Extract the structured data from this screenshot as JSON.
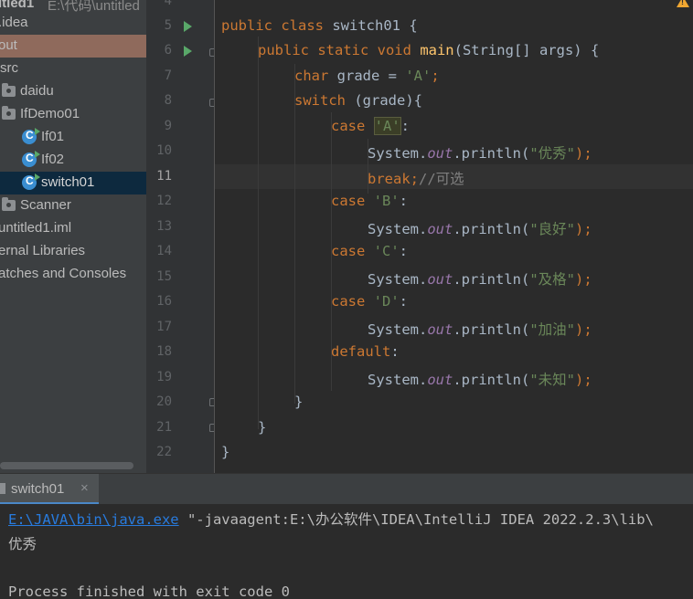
{
  "sidebar": {
    "header": "itled1",
    "header_path": "E:\\代码\\untitled",
    "items": [
      {
        "label": ".idea",
        "kind": "folder"
      },
      {
        "label": "out",
        "kind": "folder"
      },
      {
        "label": "src",
        "kind": "folder"
      },
      {
        "label": "daidu",
        "kind": "package"
      },
      {
        "label": "IfDemo01",
        "kind": "package"
      },
      {
        "label": "If01",
        "kind": "class"
      },
      {
        "label": "If02",
        "kind": "class"
      },
      {
        "label": "switch01",
        "kind": "class"
      },
      {
        "label": "Scanner",
        "kind": "package"
      },
      {
        "label": "untitled1.iml",
        "kind": "file"
      },
      {
        "label": "ernal Libraries",
        "kind": "library"
      },
      {
        "label": "atches and Consoles",
        "kind": "scratch"
      }
    ]
  },
  "editor": {
    "line_numbers": [
      "4",
      "5",
      "6",
      "7",
      "8",
      "9",
      "10",
      "11",
      "12",
      "13",
      "14",
      "15",
      "16",
      "17",
      "18",
      "19",
      "20",
      "21",
      "22"
    ],
    "current_line": "11",
    "lines": {
      "l5": [
        "public class ",
        "switch01 {"
      ],
      "l6": [
        "public static void ",
        "main",
        "(String[] args) {"
      ],
      "l7": [
        "char ",
        "grade = ",
        "'A'",
        ";"
      ],
      "l8": [
        "switch ",
        "(grade){"
      ],
      "l9": [
        "case ",
        "'A'",
        ":"
      ],
      "l10": [
        "System.",
        "out",
        ".println(",
        "\"优秀\"",
        ");"
      ],
      "l11": [
        "break",
        ";",
        "//可选"
      ],
      "l12": [
        "case ",
        "'B'",
        ":"
      ],
      "l13": [
        "System.",
        "out",
        ".println(",
        "\"良好\"",
        ");"
      ],
      "l14": [
        "case ",
        "'C'",
        ":"
      ],
      "l15": [
        "System.",
        "out",
        ".println(",
        "\"及格\"",
        ");"
      ],
      "l16": [
        "case ",
        "'D'",
        ":"
      ],
      "l17": [
        "System.",
        "out",
        ".println(",
        "\"加油\"",
        ");"
      ],
      "l18": [
        "default",
        ":"
      ],
      "l19": [
        "System.",
        "out",
        ".println(",
        "\"未知\"",
        ");"
      ],
      "l20": "}",
      "l21": "}",
      "l22": "}"
    }
  },
  "run_panel": {
    "tab_label": "switch01",
    "close_glyph": "×",
    "console": {
      "exe_link": "E:\\JAVA\\bin\\java.exe",
      "args": " \"-javaagent:E:\\办公软件\\IDEA\\IntelliJ IDEA 2022.2.3\\lib\\",
      "output": "优秀",
      "exit": "Process finished with exit code 0"
    }
  },
  "colors": {
    "keyword": "#cc7832",
    "string": "#6a8759",
    "method": "#ffc66d",
    "static_field": "#9876aa",
    "comment": "#808080",
    "link": "#287bde"
  },
  "icons": [
    "folder-icon",
    "package-icon",
    "class-icon",
    "run-gutter-icon",
    "fold-icon",
    "warning-icon",
    "close-icon"
  ]
}
